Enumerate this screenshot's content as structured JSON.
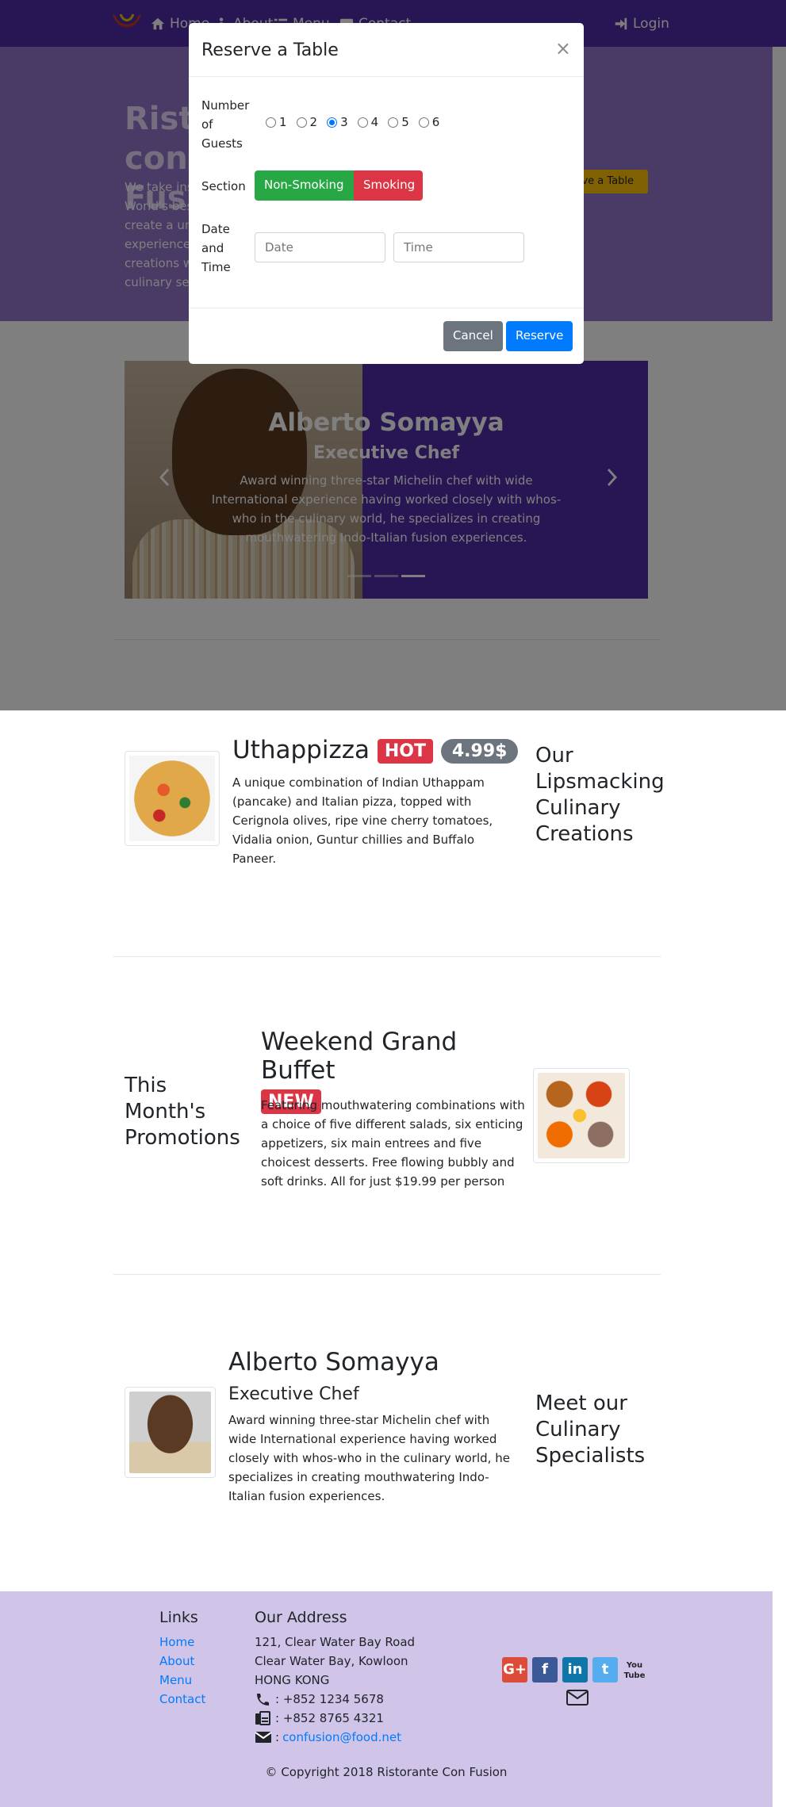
{
  "nav": {
    "items": [
      {
        "label": "Home"
      },
      {
        "label": "About"
      },
      {
        "label": "Menu"
      },
      {
        "label": "Contact"
      }
    ],
    "login_label": "Login"
  },
  "jumbotron": {
    "title": "Ristorante con Fusion",
    "text": "We take inspiration from the World's best cuisines, and create a unique fusion experience. Our lipsmacking creations will tickle your culinary senses!",
    "button_label": "Reserve a Table"
  },
  "carousel": {
    "name": "Alberto Somayya",
    "role": "Executive Chef",
    "description": "Award winning three-star Michelin chef with wide International experience having worked closely with whos-who in the culinary world, he specializes in creating mouthwatering Indo-Italian fusion experiences.",
    "active_slide": 3,
    "slide_count": 3
  },
  "modal": {
    "title": "Reserve a Table",
    "close_symbol": "×",
    "guests_label": "Number of Guests",
    "guest_options": [
      "1",
      "2",
      "3",
      "4",
      "5",
      "6"
    ],
    "guests_selected": "3",
    "section_label": "Section",
    "section_options": [
      "Non-Smoking",
      "Smoking"
    ],
    "datetime_label": "Date and Time",
    "date_placeholder": "Date",
    "time_placeholder": "Time",
    "cancel_label": "Cancel",
    "reserve_label": "Reserve"
  },
  "dish": {
    "name": "Uthappizza",
    "badge": "HOT",
    "price": "4.99$",
    "description": "A unique combination of Indian Uthappam (pancake) and Italian pizza, topped with Cerignola olives, ripe vine cherry tomatoes, Vidalia onion, Guntur chillies and Buffalo Paneer.",
    "section_heading": "Our Lipsmacking Culinary Creations"
  },
  "promotion": {
    "section_heading": "This Month's Promotions",
    "name": "Weekend Grand Buffet",
    "badge": "NEW",
    "description": "Featuring mouthwatering combinations with a choice of five different salads, six enticing appetizers, six main entrees and five choicest desserts. Free flowing bubbly and soft drinks. All for just $19.99 per person"
  },
  "leader": {
    "name": "Alberto Somayya",
    "role": "Executive Chef",
    "description": "Award winning three-star Michelin chef with wide International experience having worked closely with whos-who in the culinary world, he specializes in creating mouthwatering Indo-Italian fusion experiences.",
    "section_heading": "Meet our Culinary Specialists"
  },
  "footer": {
    "links_heading": "Links",
    "links": [
      "Home",
      "About",
      "Menu",
      "Contact"
    ],
    "address_heading": "Our Address",
    "address_lines": [
      "121, Clear Water Bay Road",
      "Clear Water Bay, Kowloon",
      "HONG KONG"
    ],
    "phone": ": +852 1234 5678",
    "fax": ": +852 8765 4321",
    "email": "confusion@food.net",
    "email_prefix": ":",
    "social": [
      {
        "name": "google-plus",
        "glyph": "G+",
        "color": "#dd4b39"
      },
      {
        "name": "facebook",
        "glyph": "f",
        "color": "#3b5998"
      },
      {
        "name": "linkedin",
        "glyph": "in",
        "color": "#0e76a8"
      },
      {
        "name": "twitter",
        "glyph": "t",
        "color": "#55acee"
      },
      {
        "name": "youtube",
        "glyph": "You Tube",
        "color": "#ffffff"
      }
    ],
    "copyright": "© Copyright 2018 Ristorante Con Fusion"
  },
  "colors": {
    "primary": "#512DA8",
    "jumbotron": "#9575CD",
    "footer": "#D1C4E9",
    "success": "#28a745",
    "danger": "#dc3545",
    "secondary": "#6c757d",
    "blue": "#007bff",
    "warning": "#FFC107"
  }
}
